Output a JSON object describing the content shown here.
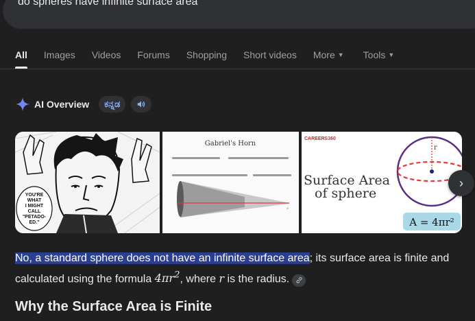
{
  "search": {
    "query": "do spheres have infinite surface area"
  },
  "tabs": {
    "all": "All",
    "images": "Images",
    "videos": "Videos",
    "forums": "Forums",
    "shopping": "Shopping",
    "short_videos": "Short videos",
    "more": "More",
    "tools": "Tools"
  },
  "ai_overview": {
    "label": "AI Overview",
    "language_chip": "ಕನ್ನಡ"
  },
  "images": {
    "manga_bubble": [
      "YOU'RE",
      "WHAT",
      "I MIGHT",
      "CALL",
      "\"PETADO-",
      "ED.\""
    ],
    "horn_title": "Gabriel's Horn",
    "careers_logo": "CAREERS360",
    "sphere_title_1": "Surface Area",
    "sphere_title_2": "of sphere",
    "sphere_r": "r",
    "sphere_formula": "A = 4πr²"
  },
  "answer": {
    "highlight": "No, a standard sphere does not have an infinite surface area",
    "rest1": "; its surface area is finite and calculated using the formula ",
    "formula": "4πr",
    "formula_sup": "2",
    "rest2": ", where ",
    "var": "r",
    "rest3": " is the radius."
  },
  "section": {
    "heading": "Why the Surface Area is Finite"
  },
  "colors": {
    "background": "#1f1f1f",
    "highlight": "#2a3f8f",
    "link": "#8ab4f8"
  }
}
